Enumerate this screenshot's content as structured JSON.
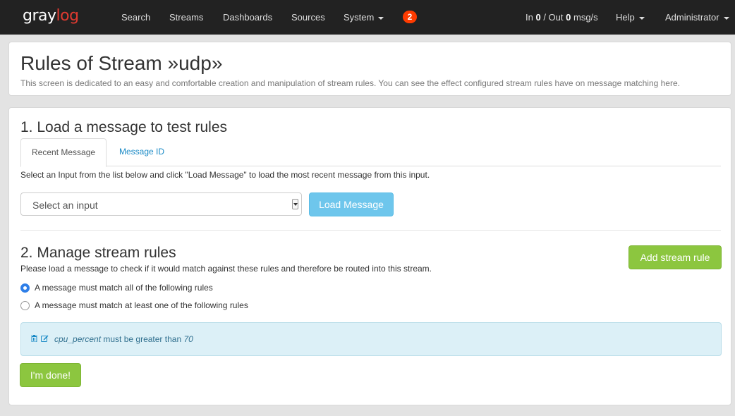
{
  "navbar": {
    "logo_main": "gray",
    "logo_accent": "log",
    "items": [
      {
        "label": "Search"
      },
      {
        "label": "Streams"
      },
      {
        "label": "Dashboards"
      },
      {
        "label": "Sources"
      },
      {
        "label": "System"
      }
    ],
    "notification_count": "2",
    "throughput": {
      "in_label": "In",
      "in_value": "0",
      "separator": "/ Out",
      "out_value": "0",
      "unit": "msg/s"
    },
    "help_label": "Help",
    "user_label": "Administrator"
  },
  "header": {
    "title": "Rules of Stream »udp»",
    "description": "This screen is dedicated to an easy and comfortable creation and manipulation of stream rules. You can see the effect configured stream rules have on message matching here."
  },
  "load_section": {
    "title": "1. Load a message to test rules",
    "tabs": [
      {
        "label": "Recent Message",
        "active": true
      },
      {
        "label": "Message ID",
        "active": false
      }
    ],
    "help_text": "Select an Input from the list below and click \"Load Message\" to load the most recent message from this input.",
    "select_placeholder": "Select an input",
    "load_button": "Load Message"
  },
  "manage_section": {
    "title": "2. Manage stream rules",
    "add_button": "Add stream rule",
    "help_text": "Please load a message to check if it would match against these rules and therefore be routed into this stream.",
    "match_options": [
      {
        "label": "A message must match all of the following rules",
        "checked": true
      },
      {
        "label": "A message must match at least one of the following rules",
        "checked": false
      }
    ],
    "rule": {
      "field": "cpu_percent",
      "condition": "must be greater than",
      "value": "70"
    },
    "done_button": "I'm done!"
  },
  "colors": {
    "navbar_bg": "#222222",
    "accent_red": "#e03a30",
    "badge": "#ff3b00",
    "link_blue": "#1a8ac6",
    "success_green": "#8cc63f",
    "info_blue": "#6ec6ec",
    "rule_bg": "#dcf0f7"
  },
  "icons": [
    "caret-down-icon",
    "trash-icon",
    "edit-icon",
    "radio-checked-icon",
    "radio-unchecked-icon",
    "select-arrow-icon"
  ]
}
